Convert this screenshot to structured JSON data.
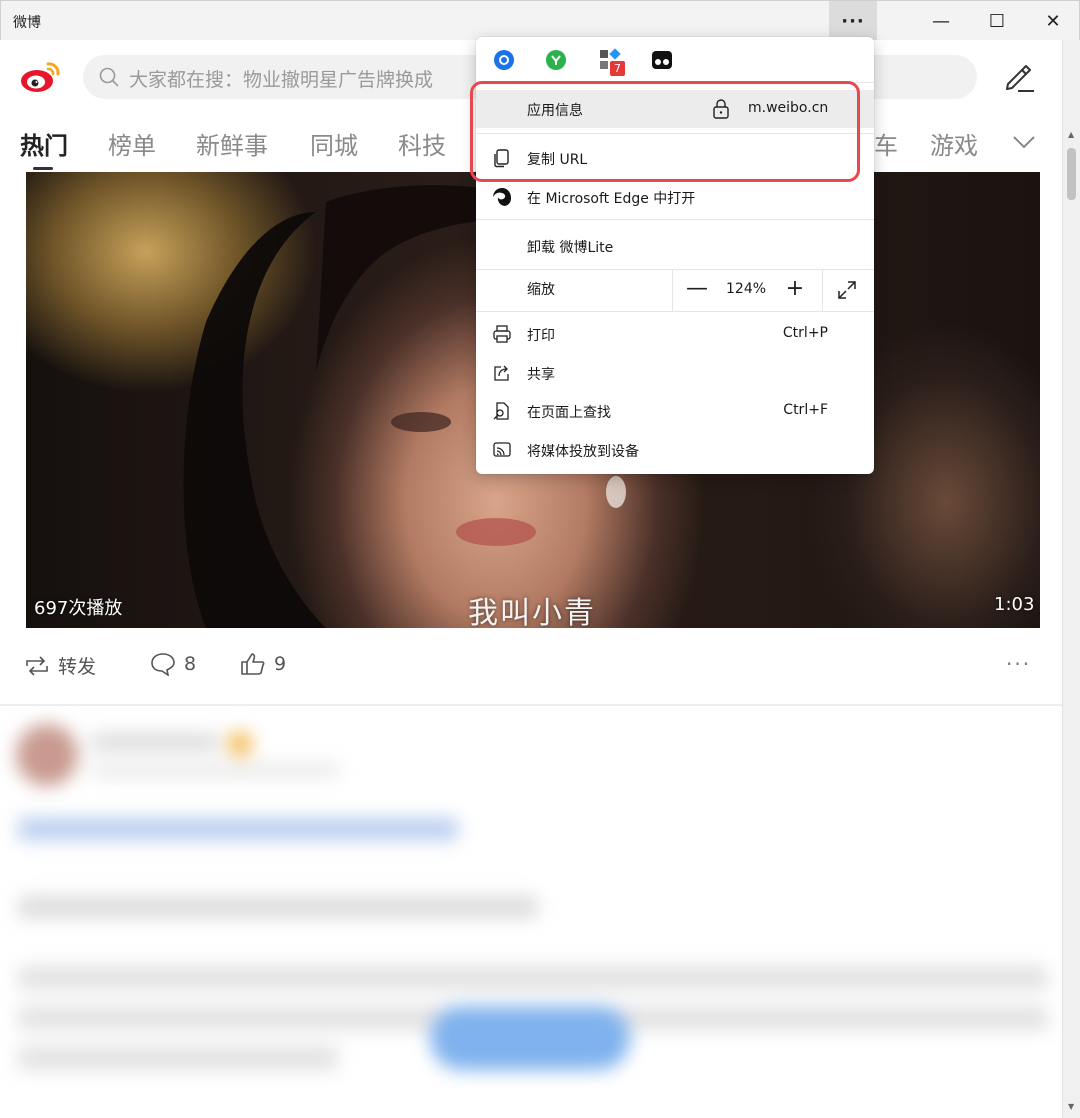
{
  "window": {
    "title": "微博",
    "more_label": "···",
    "minimize": "—",
    "maximize": "☐",
    "close": "✕"
  },
  "header": {
    "search_placeholder": "大家都在搜：物业撤明星广告牌换成",
    "tabs": [
      "热门",
      "榜单",
      "新鲜事",
      "同城",
      "科技",
      "车",
      "游戏"
    ],
    "active_tab": "热门"
  },
  "video": {
    "views": "697次播放",
    "subtitle": "我叫小青",
    "duration": "1:03"
  },
  "actions": {
    "repost_label": "转发",
    "comment_count": "8",
    "like_count": "9",
    "more": "···"
  },
  "menu": {
    "extension_badge": "7",
    "app_info_label": "应用信息",
    "app_url": "m.weibo.cn",
    "copy_url_label": "复制 URL",
    "open_in_edge_label": "在 Microsoft Edge 中打开",
    "uninstall_label": "卸载 微博Lite",
    "zoom_label": "缩放",
    "zoom_value": "124%",
    "zoom_minus": "—",
    "zoom_plus": "+",
    "print_label": "打印",
    "print_shortcut": "Ctrl+P",
    "share_label": "共享",
    "find_label": "在页面上查找",
    "find_shortcut": "Ctrl+F",
    "cast_label": "将媒体投放到设备"
  },
  "colors": {
    "highlight_border": "#e8474d",
    "weibo_red": "#e6162d",
    "weibo_orange": "#f5a623"
  }
}
